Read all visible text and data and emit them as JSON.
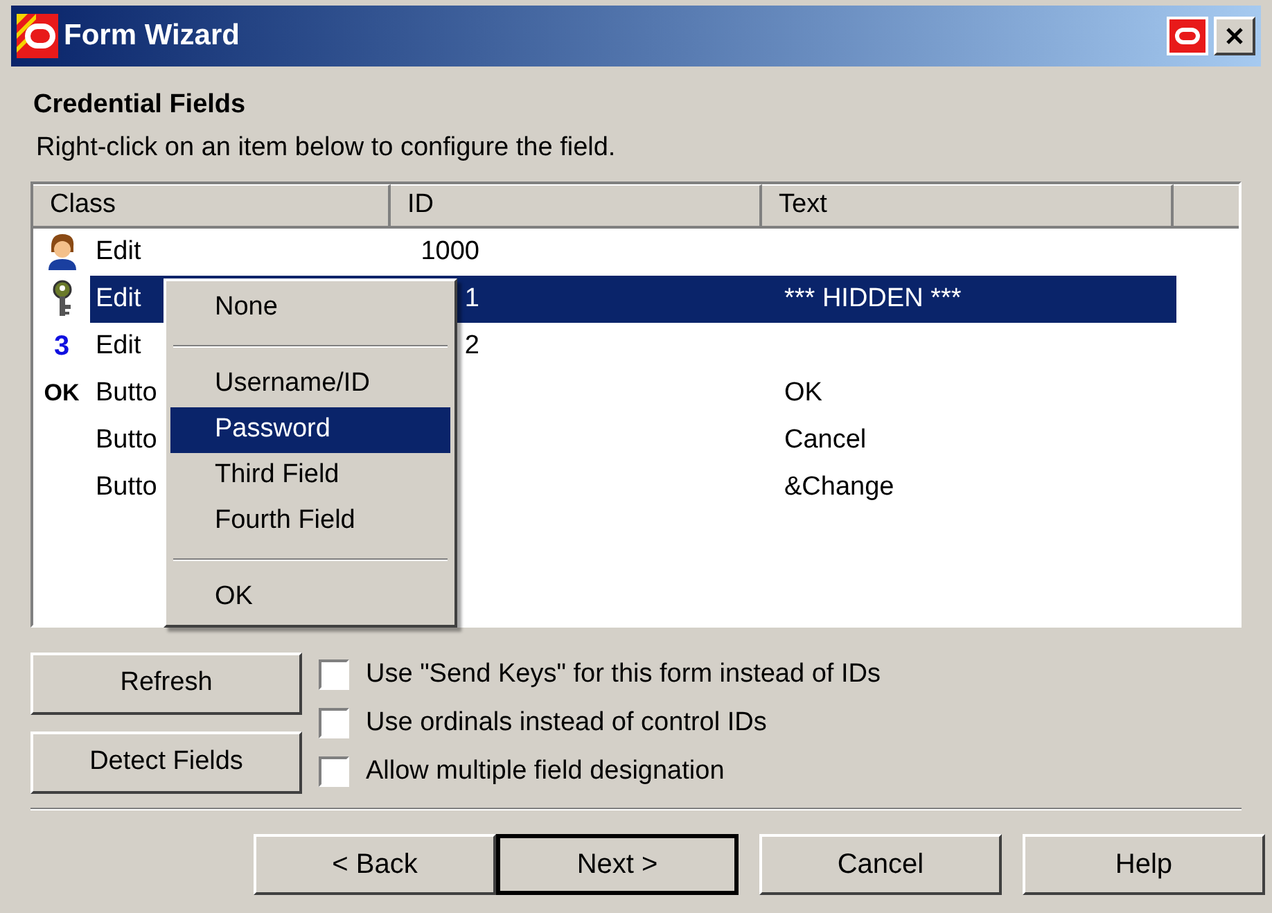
{
  "window": {
    "title": "Form Wizard"
  },
  "header": {
    "title": "Credential Fields",
    "subtitle": "Right-click on an item below to configure the field."
  },
  "table": {
    "columns": [
      "Class",
      "ID",
      "Text"
    ],
    "rows": [
      {
        "kind": "person",
        "class": "Edit",
        "id": "1000",
        "selected": false
      },
      {
        "kind": "key",
        "class": "Edit",
        "id": "1",
        "text": "*** HIDDEN ***",
        "selected": true
      },
      {
        "kind": "badge",
        "badge": "3",
        "class": "Edit",
        "id": "2",
        "selected": false
      },
      {
        "kind": "badge",
        "badge": "OK",
        "class": "Butto",
        "text": "OK",
        "selected": false
      },
      {
        "kind": "plain",
        "class": "Butto",
        "text": "Cancel",
        "selected": false
      },
      {
        "kind": "plain",
        "class": "Butto",
        "text": "&Change",
        "selected": false
      }
    ]
  },
  "context_menu": {
    "items": [
      {
        "kind": "item",
        "label": "None",
        "selected": false
      },
      {
        "kind": "separator"
      },
      {
        "kind": "item",
        "label": "Username/ID",
        "selected": false
      },
      {
        "kind": "item",
        "label": "Password",
        "selected": true
      },
      {
        "kind": "item",
        "label": "Third Field",
        "selected": false
      },
      {
        "kind": "item",
        "label": "Fourth Field",
        "selected": false
      },
      {
        "kind": "separator"
      },
      {
        "kind": "item",
        "label": "OK",
        "selected": false
      }
    ]
  },
  "side_buttons": [
    "Refresh",
    "Detect Fields"
  ],
  "options": [
    {
      "label": "Use \"Send Keys\" for this form instead of IDs",
      "checked": false
    },
    {
      "label": "Use ordinals instead of control IDs",
      "checked": false
    },
    {
      "label": "Allow multiple field designation",
      "checked": false
    }
  ],
  "buttons": [
    {
      "label": "< Back",
      "default": false
    },
    {
      "label": "Next >",
      "default": true
    },
    {
      "label": "Cancel",
      "default": false
    },
    {
      "label": "Help",
      "default": false
    }
  ]
}
